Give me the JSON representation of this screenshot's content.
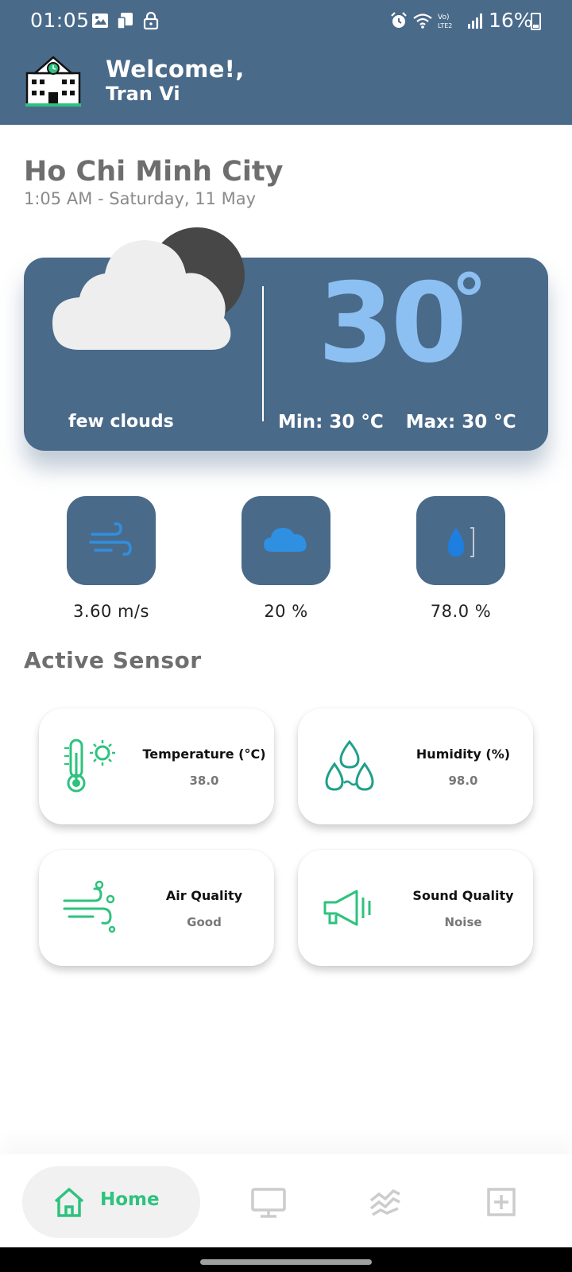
{
  "status_bar": {
    "time": "01:05",
    "battery": "16%",
    "icons_left": [
      "gallery-icon",
      "screen-mirror-icon",
      "lock-icon"
    ],
    "icons_right": [
      "alarm-icon",
      "wifi-icon",
      "volte-icon",
      "signal-icon",
      "battery-icon"
    ]
  },
  "header": {
    "welcome": "Welcome!,",
    "username": "Tran Vi",
    "logo_icon": "school-building-icon"
  },
  "location": {
    "city": "Ho Chi Minh City",
    "datetime": "1:05 AM - Saturday, 11 May"
  },
  "weather": {
    "temperature": "30",
    "degree_symbol": "°",
    "description": "few clouds",
    "min": "Min: 30 °C",
    "max": "Max: 30 °C",
    "icon": "cloud-moon-icon"
  },
  "stats": [
    {
      "icon": "wind-icon",
      "value": "3.60 m/s"
    },
    {
      "icon": "cloud-icon",
      "value": "20 %"
    },
    {
      "icon": "humidity-drop-icon",
      "value": "78.0 %"
    }
  ],
  "active_sensor": {
    "title": "Active Sensor",
    "sensors": [
      {
        "icon": "thermometer-sun-icon",
        "label": "Temperature (°C)",
        "value": "38.0"
      },
      {
        "icon": "water-drops-icon",
        "label": "Humidity (%)",
        "value": "98.0"
      },
      {
        "icon": "air-wind-icon",
        "label": "Air Quality",
        "value": "Good"
      },
      {
        "icon": "megaphone-icon",
        "label": "Sound Quality",
        "value": "Noise"
      }
    ]
  },
  "bottom_nav": {
    "home_label": "Home",
    "items": [
      "home-icon",
      "monitor-icon",
      "chart-icon",
      "add-icon"
    ],
    "active_color": "#2ec27e"
  },
  "colors": {
    "primary": "#4a6a8a",
    "temp_text": "#8cc0f2",
    "accent_green": "#2ec27e"
  }
}
